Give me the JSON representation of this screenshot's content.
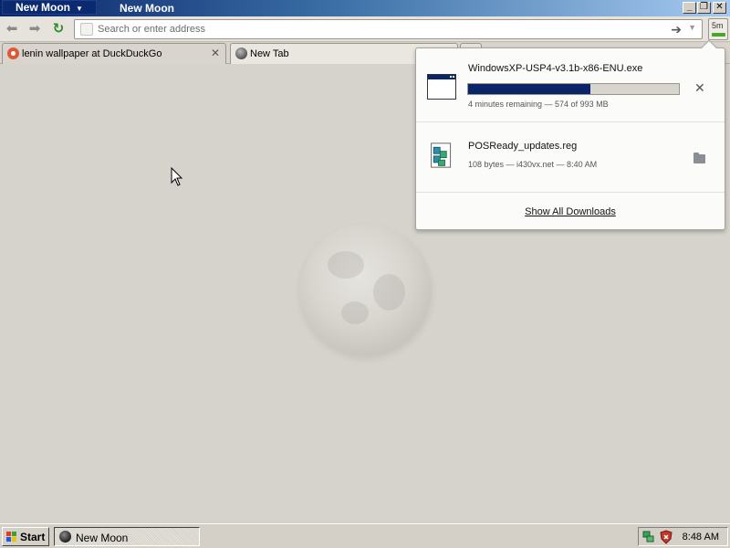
{
  "window": {
    "app_menu_label": "New Moon",
    "title": "New Moon"
  },
  "navbar": {
    "address_placeholder": "Search or enter address",
    "downloads_indicator_text": "5m"
  },
  "tabs": [
    {
      "label": "lenin wallpaper at DuckDuckGo",
      "active": false
    },
    {
      "label": "New Tab",
      "active": true
    }
  ],
  "downloads": {
    "items": [
      {
        "filename": "WindowsXP-USP4-v3.1b-x86-ENU.exe",
        "status": "4 minutes remaining — 574 of 993 MB",
        "progress_fraction": 0.578,
        "icon": "executable-file-icon"
      },
      {
        "filename": "POSReady_updates.reg",
        "status": "108 bytes — i430vx.net — 8:40 AM",
        "icon": "registry-file-icon"
      }
    ],
    "show_all_label": "Show All Downloads"
  },
  "taskbar": {
    "start_label": "Start",
    "task_label": "New Moon",
    "clock": "8:48 AM"
  },
  "colors": {
    "titlebar_start": "#0a246a",
    "progress_fill": "#0a246a",
    "download_indicator": "#49a62a"
  }
}
